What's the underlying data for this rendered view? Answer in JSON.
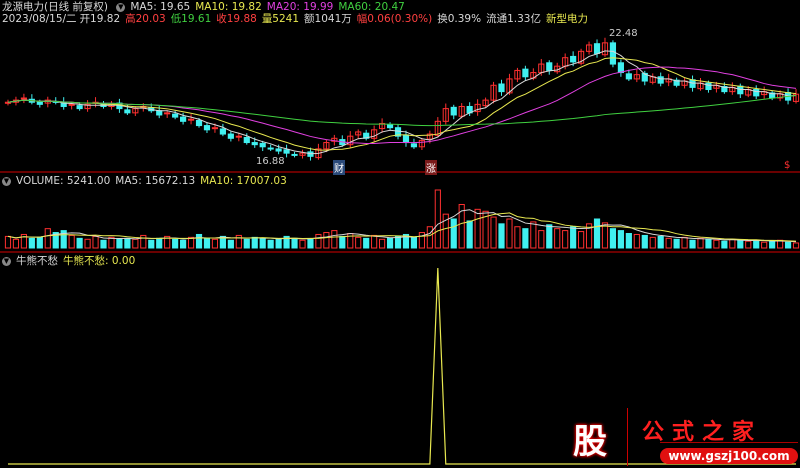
{
  "header": {
    "name": "龙源电力",
    "period": "(日线 前复权)",
    "ma5": "MA5: 19.65",
    "ma10": "MA10: 19.82",
    "ma20": "MA20: 19.99",
    "ma60": "MA60: 20.47",
    "date": "2023/08/15/二",
    "open": "开19.82",
    "high": "高20.03",
    "low": "低19.61",
    "close": "收19.88",
    "vol": "量5241",
    "amount": "额1041万",
    "change": "幅0.06(0.30%)",
    "turnover": "换0.39%",
    "float": "流通1.33亿",
    "sector": "新型电力"
  },
  "volume_header": {
    "label": "VOLUME: 5241.00",
    "ma5": "MA5: 15672.13",
    "ma10": "MA10: 17007.03"
  },
  "indicator_header": {
    "name": "牛熊不愁",
    "value_label": "牛熊不愁: 0.00"
  },
  "annotations": {
    "high": "22.48",
    "low": "16.88",
    "mark_cai": "财",
    "mark_zhang": "涨",
    "mark_s": "$"
  },
  "logo": {
    "char": "股",
    "title": "公式之家",
    "url": "www.gszj100.com"
  },
  "colors": {
    "up": "#ff3030",
    "down": "#40f0f0",
    "ma5": "#d8d8d8",
    "ma10": "#e8e850",
    "ma20": "#e040e0",
    "ma60": "#40d040"
  },
  "chart_data": {
    "type": "candlestick",
    "price_range": [
      16.4,
      23.0
    ],
    "close": [
      19.5,
      19.6,
      19.7,
      19.5,
      19.4,
      19.6,
      19.5,
      19.3,
      19.4,
      19.2,
      19.4,
      19.5,
      19.3,
      19.4,
      19.2,
      19.0,
      19.2,
      19.3,
      19.1,
      18.9,
      19.0,
      18.8,
      18.6,
      18.7,
      18.4,
      18.2,
      18.3,
      18.0,
      17.8,
      17.9,
      17.6,
      17.5,
      17.4,
      17.3,
      17.2,
      17.1,
      17.0,
      17.1,
      16.95,
      17.3,
      17.6,
      17.8,
      17.5,
      17.9,
      18.1,
      17.8,
      18.2,
      18.5,
      18.3,
      17.9,
      17.6,
      17.4,
      17.7,
      18.0,
      18.6,
      19.2,
      18.9,
      19.3,
      19.0,
      19.4,
      19.6,
      20.3,
      20.0,
      20.6,
      21.0,
      20.7,
      20.9,
      21.3,
      21.0,
      21.2,
      21.6,
      21.4,
      21.9,
      22.2,
      21.8,
      22.3,
      21.3,
      20.9,
      20.6,
      20.8,
      20.5,
      20.7,
      20.4,
      20.6,
      20.3,
      20.5,
      20.2,
      20.4,
      20.1,
      20.3,
      20.0,
      20.2,
      19.9,
      20.1,
      19.8,
      20.0,
      19.7,
      19.9,
      19.6,
      19.88
    ],
    "volume": [
      12,
      9,
      14,
      10,
      11,
      20,
      16,
      18,
      13,
      10,
      9,
      12,
      8,
      11,
      9,
      10,
      9,
      13,
      8,
      10,
      12,
      9,
      8,
      11,
      14,
      10,
      9,
      12,
      8,
      13,
      9,
      11,
      10,
      8,
      9,
      12,
      10,
      8,
      9,
      14,
      16,
      18,
      12,
      15,
      11,
      10,
      13,
      9,
      10,
      12,
      14,
      11,
      16,
      22,
      60,
      35,
      30,
      45,
      28,
      40,
      38,
      32,
      25,
      30,
      22,
      20,
      27,
      18,
      24,
      20,
      18,
      22,
      17,
      25,
      30,
      26,
      20,
      18,
      15,
      14,
      13,
      11,
      12,
      10,
      9,
      11,
      8,
      10,
      9,
      8,
      7,
      9,
      8,
      7,
      8,
      6,
      7,
      8,
      6,
      5.2
    ],
    "indicator": [
      0,
      0,
      0,
      0,
      0,
      0,
      0,
      0,
      0,
      0,
      0,
      0,
      0,
      0,
      0,
      0,
      0,
      0,
      0,
      0,
      0,
      0,
      0,
      0,
      0,
      0,
      0,
      0,
      0,
      0,
      0,
      0,
      0,
      0,
      0,
      0,
      0,
      0,
      0,
      0,
      0,
      0,
      0,
      0,
      0,
      0,
      0,
      0,
      0,
      0,
      0,
      0,
      0,
      0,
      1,
      0,
      0,
      0,
      0,
      0,
      0,
      0,
      0,
      0,
      0,
      0,
      0,
      0,
      0,
      0,
      0,
      0,
      0,
      0,
      0,
      0,
      0,
      0,
      0,
      0,
      0,
      0,
      0,
      0,
      0,
      0,
      0,
      0,
      0,
      0,
      0,
      0,
      0,
      0,
      0,
      0,
      0,
      0,
      0,
      0
    ]
  }
}
